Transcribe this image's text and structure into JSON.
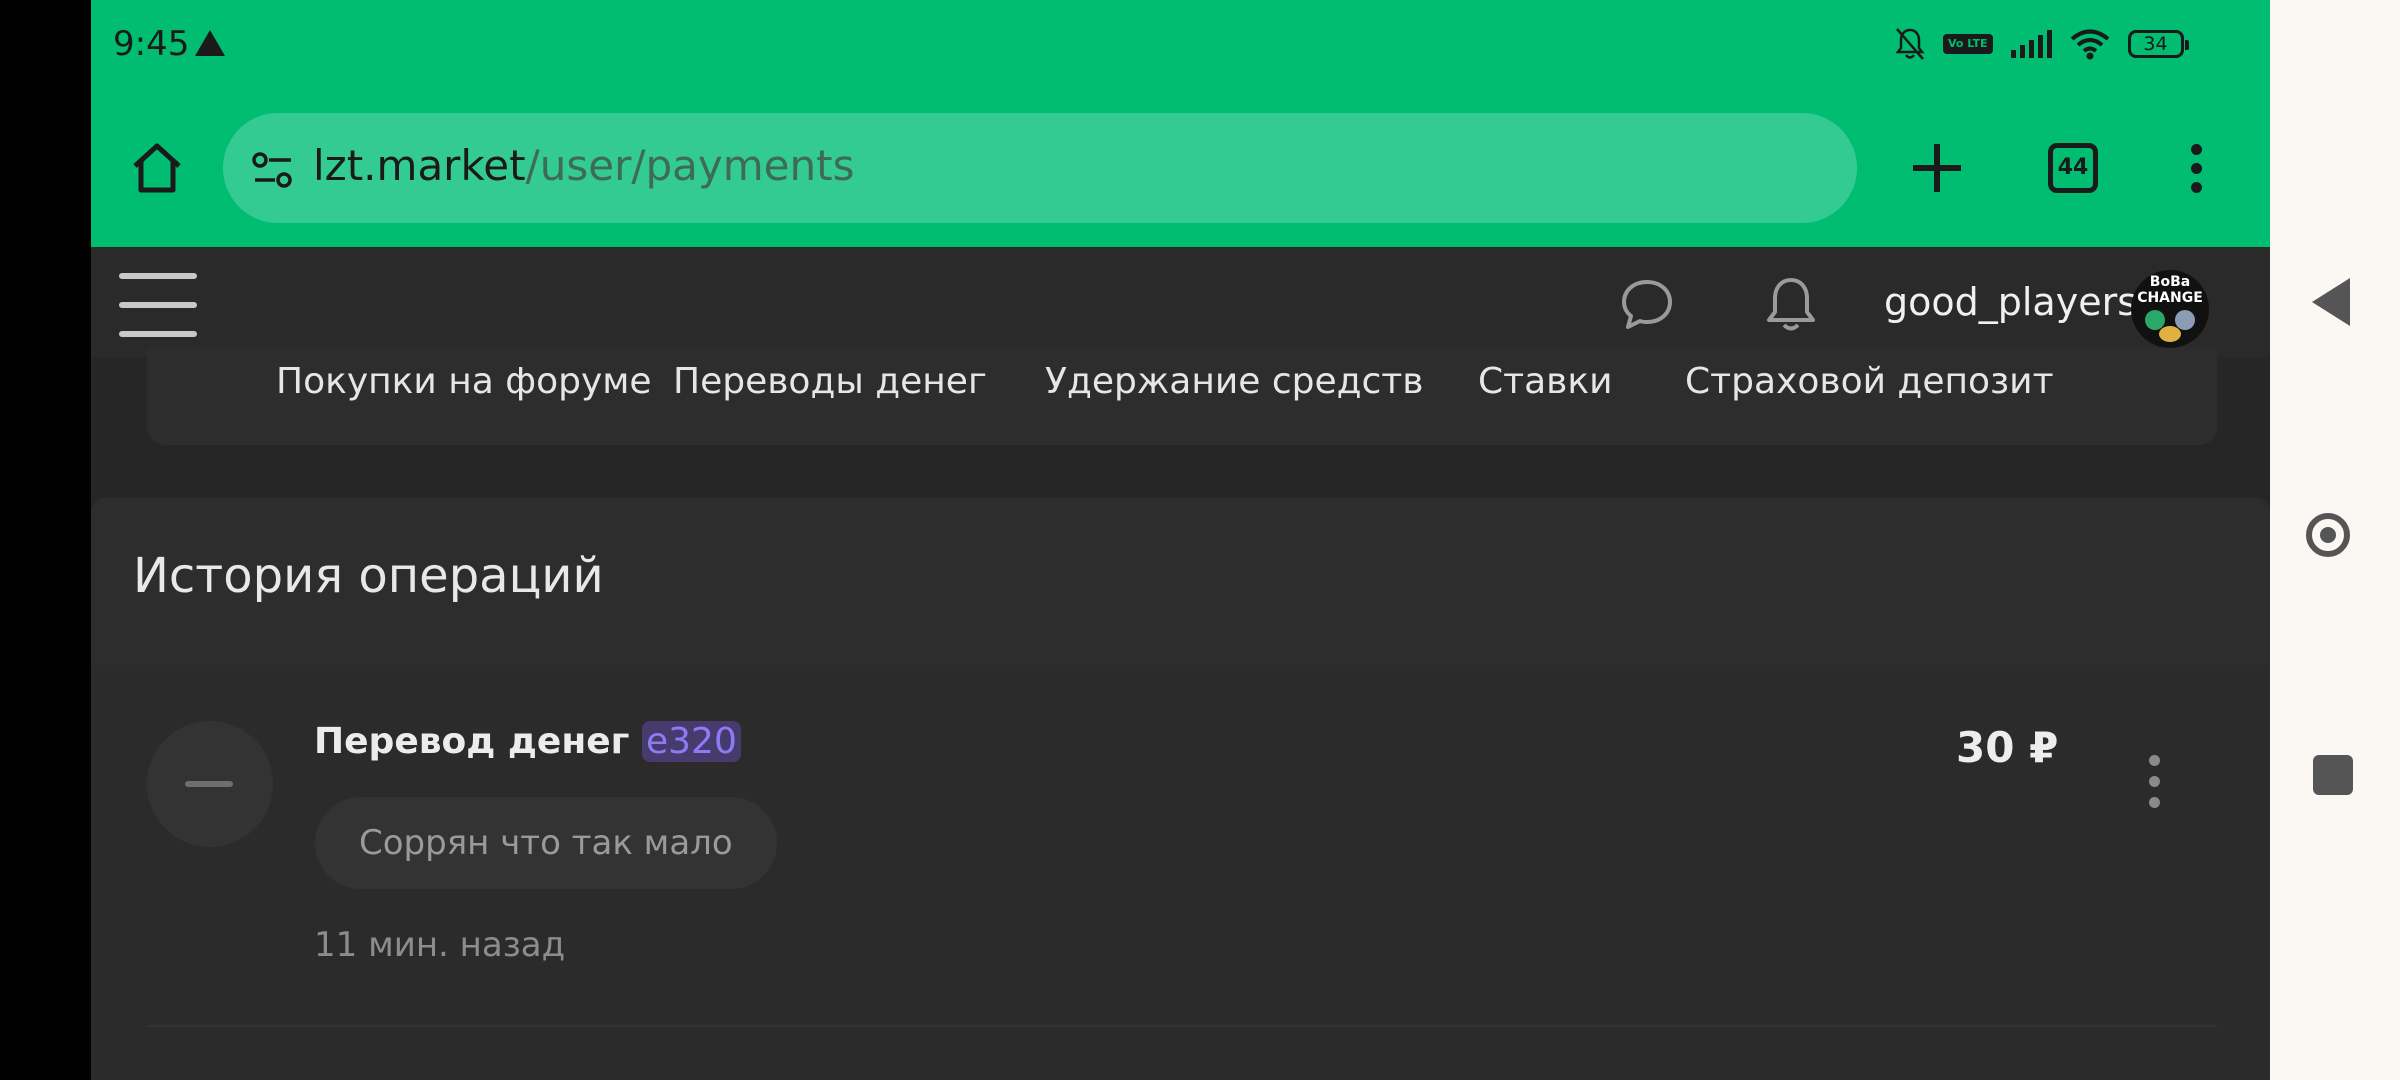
{
  "status_bar": {
    "time": "9:45",
    "volte": "Vo LTE",
    "battery": "34"
  },
  "browser": {
    "url_domain": "lzt.market",
    "url_path": "/user/payments",
    "tab_count": "44"
  },
  "site_header": {
    "username": "good_players",
    "avatar_text": "BoBa CHANGE"
  },
  "payment_tabs": [
    {
      "label": "Покупки на форуме"
    },
    {
      "label": "Переводы денег"
    },
    {
      "label": "Удержание средств"
    },
    {
      "label": "Ставки"
    },
    {
      "label": "Страховой депозит"
    }
  ],
  "history": {
    "title": "История операций",
    "operations": [
      {
        "title": "Перевод денег",
        "user": "e320",
        "comment": "Соррян что так мало",
        "time": "11 мин. назад",
        "amount": "30 ₽"
      }
    ]
  },
  "colors": {
    "browser_chrome": "#00bd72",
    "username_highlight": "#8b7cf6",
    "page_background": "#262626"
  }
}
